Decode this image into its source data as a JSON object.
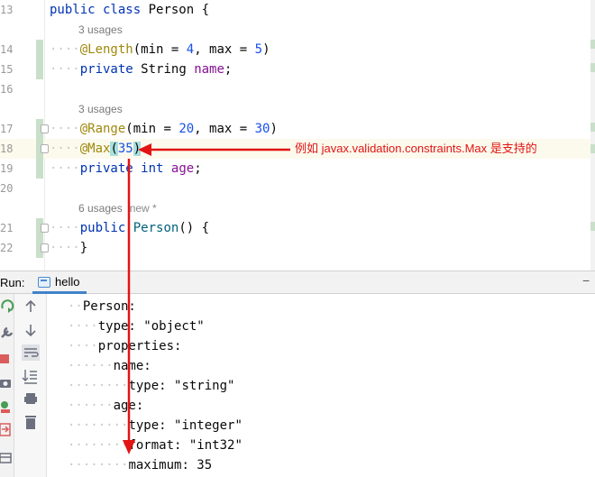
{
  "editor": {
    "line_numbers": [
      "13",
      "14",
      "15",
      "16",
      "17",
      "18",
      "19",
      "20",
      "21",
      "22"
    ],
    "class_decl": {
      "kw": "public class",
      "name": "Person",
      "brace": "{"
    },
    "usages_1": "3 usages",
    "length_ann": {
      "name": "@Length",
      "open": "(min = ",
      "min": "4",
      "mid": ", max = ",
      "max": "5",
      "close": ")"
    },
    "name_field": {
      "kw": "private",
      "type": "String",
      "name": "name",
      "semi": ";"
    },
    "usages_2": "3 usages",
    "range_ann": {
      "name": "@Range",
      "open": "(min = ",
      "min": "20",
      "mid": ", max = ",
      "max": "30",
      "close": ")"
    },
    "max_ann": {
      "name": "@Max",
      "paren_open": "(",
      "value": "35",
      "paren_close": ")"
    },
    "age_field": {
      "kw1": "private",
      "kw2": "int",
      "name": "age",
      "semi": ";"
    },
    "usages_3": "6 usages",
    "new_hint": "new *",
    "ctor": {
      "kw": "public",
      "name": "Person",
      "rest": "() {"
    },
    "ctor_close": "}"
  },
  "callout_text": "例如 javax.validation.constraints.Max 是支持的",
  "run": {
    "label": "Run:",
    "tab": "hello",
    "minus": "−"
  },
  "console_lines": [
    {
      "ind": "··",
      "text": "Person:"
    },
    {
      "ind": "····",
      "text": "type: \"object\""
    },
    {
      "ind": "····",
      "text": "properties:"
    },
    {
      "ind": "······",
      "text": "name:"
    },
    {
      "ind": "········",
      "text": "type: \"string\""
    },
    {
      "ind": "······",
      "text": "age:"
    },
    {
      "ind": "········",
      "text": "type: \"integer\""
    },
    {
      "ind": "········",
      "text": "format: \"int32\""
    },
    {
      "ind": "········",
      "text": "maximum: 35"
    }
  ],
  "icons": {
    "left_tools": [
      "rerun-icon",
      "wrench-icon",
      "stop-icon",
      "camera-icon",
      "settings-bug-icon",
      "exit-icon",
      "layout-icon"
    ],
    "inner_tools": [
      "up-arrow-icon",
      "down-arrow-icon",
      "soft-wrap-icon",
      "scroll-to-end-icon",
      "print-icon",
      "trash-icon"
    ]
  },
  "colors": {
    "keyword": "#0033b3",
    "annotation": "#9e880d",
    "number": "#1750eb",
    "field": "#871094",
    "string": "#067d17",
    "arrow": "#e21414",
    "current_line": "#fcfaed",
    "match_highlight": "#a8e0de"
  }
}
